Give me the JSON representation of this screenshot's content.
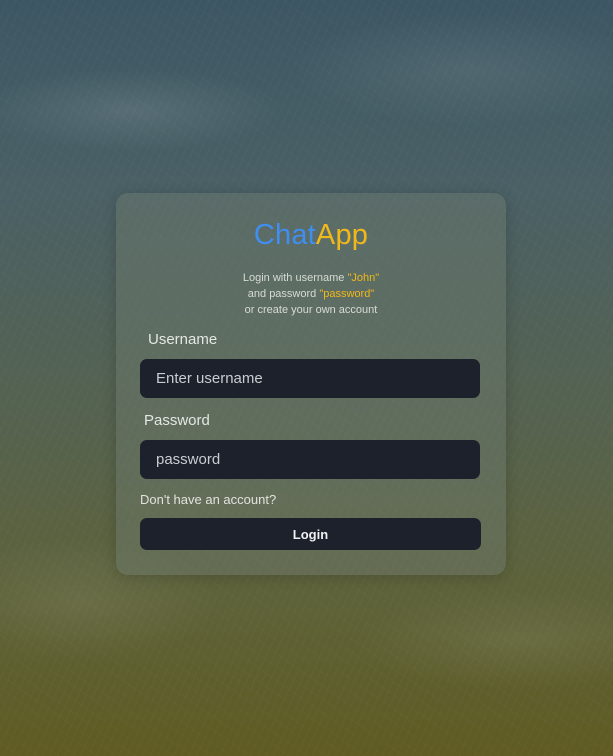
{
  "app": {
    "title_part1": "Chat",
    "title_part2": "App",
    "brand_colors": {
      "primary": "#3f8ef0",
      "accent": "#f0b81a"
    }
  },
  "hint": {
    "line1_prefix": "Login with username ",
    "line1_value": "\"John\"",
    "line2_prefix": "and password ",
    "line2_value": "\"password\"",
    "line3": "or create your own account"
  },
  "form": {
    "username_label": "Username",
    "username_placeholder": "Enter username",
    "username_value": "",
    "password_label": "Password",
    "password_placeholder": "password",
    "password_value": "",
    "signup_link": "Don't have an account?",
    "login_button": "Login"
  }
}
